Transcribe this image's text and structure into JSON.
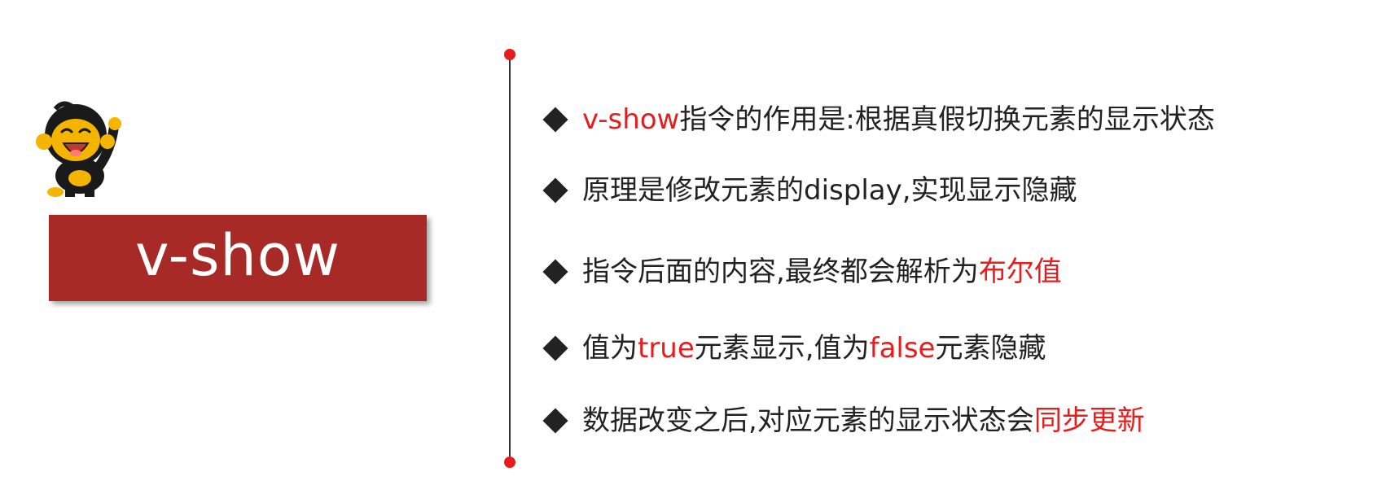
{
  "slide": {
    "title": "v-show",
    "colors": {
      "title_bg": "#a82a27",
      "title_text": "#ffffff",
      "highlight": "#e81c1c",
      "body_text": "#222222",
      "divider": "#333333",
      "divider_dot": "#e81c1c"
    },
    "mascot_icon": "cartoon-monkey-mascot",
    "bullets": [
      {
        "segments": [
          {
            "text": "v-show",
            "highlight": true
          },
          {
            "text": "指令的作用是:根据真假切换元素的显示状态",
            "highlight": false
          }
        ]
      },
      {
        "segments": [
          {
            "text": "原理是修改元素的display,实现显示隐藏",
            "highlight": false
          }
        ]
      },
      {
        "segments": [
          {
            "text": "指令后面的内容,最终都会解析为",
            "highlight": false
          },
          {
            "text": "布尔值",
            "highlight": true
          }
        ]
      },
      {
        "segments": [
          {
            "text": "值为",
            "highlight": false
          },
          {
            "text": "true",
            "highlight": true
          },
          {
            "text": "元素显示,值为",
            "highlight": false
          },
          {
            "text": "false",
            "highlight": true
          },
          {
            "text": "元素隐藏",
            "highlight": false
          }
        ]
      },
      {
        "segments": [
          {
            "text": "数据改变之后,对应元素的显示状态会",
            "highlight": false
          },
          {
            "text": "同步更新",
            "highlight": true
          }
        ]
      }
    ]
  }
}
